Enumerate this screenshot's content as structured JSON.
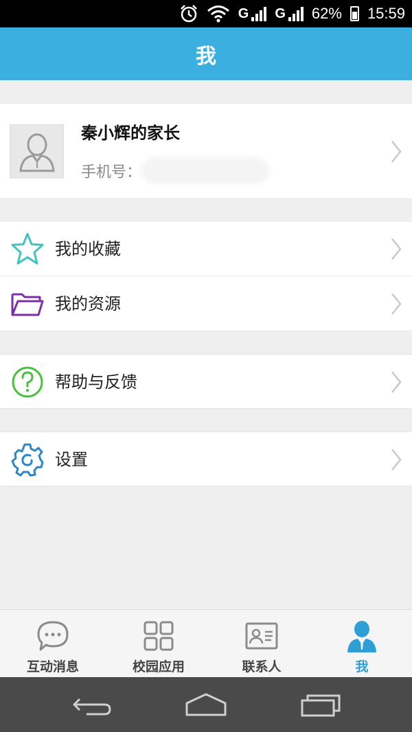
{
  "status_bar": {
    "signal1": "G",
    "signal2": "G",
    "battery": "62%",
    "time": "15:59"
  },
  "header": {
    "title": "我"
  },
  "profile": {
    "name": "秦小辉的家长",
    "phone_label": "手机号："
  },
  "menu": {
    "favorites": "我的收藏",
    "resources": "我的资源",
    "help": "帮助与反馈",
    "settings": "设置"
  },
  "tabs": [
    {
      "label": "互动消息",
      "icon": "chat-bubble-icon"
    },
    {
      "label": "校园应用",
      "icon": "grid-apps-icon"
    },
    {
      "label": "联系人",
      "icon": "contact-card-icon"
    },
    {
      "label": "我",
      "icon": "person-icon"
    }
  ],
  "colors": {
    "primary": "#3bafe0",
    "active_tab": "#2e9fd6",
    "favorites_icon": "#3fc4c2",
    "resources_icon": "#7b2ea8",
    "help_icon": "#4bbf3e",
    "settings_icon": "#2a86c9"
  }
}
